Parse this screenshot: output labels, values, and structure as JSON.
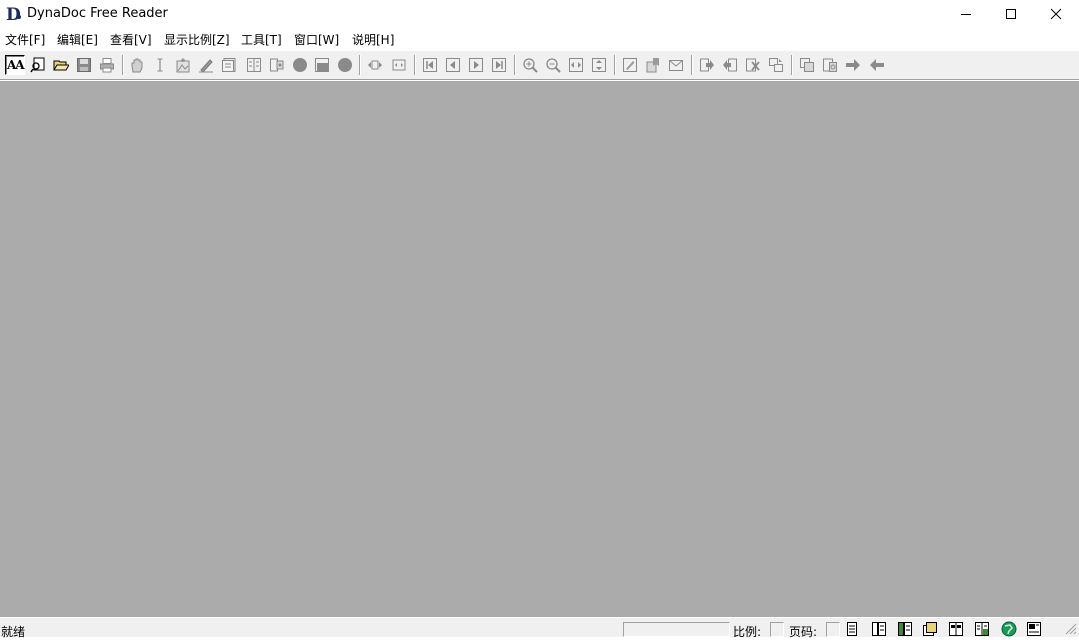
{
  "window": {
    "title": "DynaDoc Free Reader",
    "app_icon_letter": "D",
    "controls": [
      "minimize-icon",
      "maximize-icon",
      "close-icon"
    ]
  },
  "menu": {
    "items": [
      "文件[F]",
      "编辑[E]",
      "查看[V]",
      "显示比例[Z]",
      "工具[T]",
      "窗口[W]",
      "说明[H]"
    ]
  },
  "toolbar": {
    "text_tool_label": "AA",
    "buttons": [
      "text-select-tool-icon",
      "find-text-icon",
      "open-file-icon",
      "save-icon",
      "print-icon",
      "hand-tool-icon",
      "text-cursor-icon",
      "snapshot-icon",
      "pen-icon",
      "notes-icon",
      "columns-icon",
      "link-icon",
      "circle-icon",
      "stamp-icon",
      "circle-icon",
      "fit-width-icon",
      "fit-page-icon",
      "first-page-icon",
      "previous-page-icon",
      "next-page-icon",
      "last-page-icon",
      "zoom-in-icon",
      "zoom-out-icon",
      "fit-horizontal-icon",
      "fit-vertical-icon",
      "doc-edit-icon",
      "bookmark-icon",
      "envelope-icon",
      "export-icon",
      "import-icon",
      "delete-icon",
      "replace-icon",
      "copy-page-icon",
      "paste-page-icon",
      "forward-arrow-icon",
      "back-arrow-icon"
    ]
  },
  "status": {
    "text": "就绪",
    "zoom_label": "比例:",
    "page_label": "页码:",
    "view_icons": [
      "single-page-icon",
      "continuous-page-icon",
      "facing-pages-icon",
      "cover-page-icon",
      "book-view-icon",
      "document-info-icon",
      "globe-icon",
      "print-preview-icon"
    ]
  },
  "colors": {
    "workspace": "#ababab",
    "chrome": "#f0f0f0",
    "titlebar": "#ffffff"
  }
}
